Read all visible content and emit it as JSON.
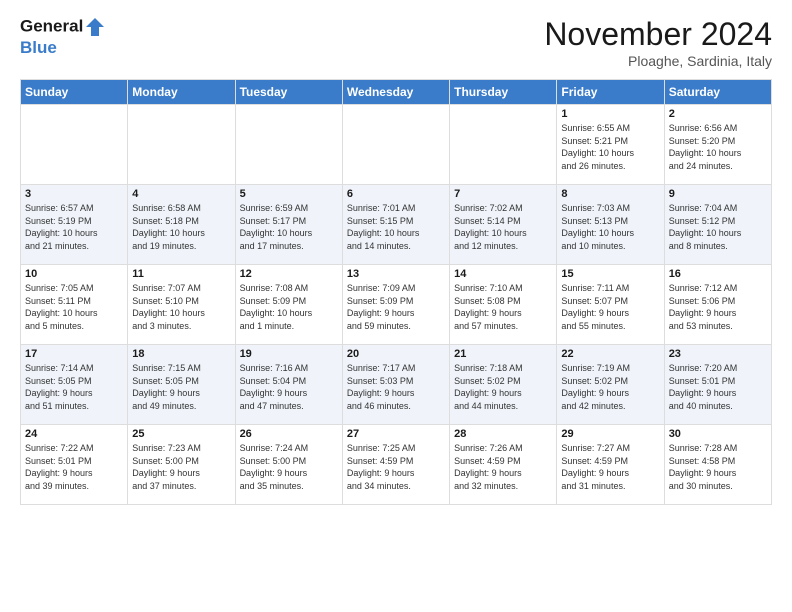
{
  "header": {
    "logo_line1": "General",
    "logo_line2": "Blue",
    "month_title": "November 2024",
    "location": "Ploaghe, Sardinia, Italy"
  },
  "days_of_week": [
    "Sunday",
    "Monday",
    "Tuesday",
    "Wednesday",
    "Thursday",
    "Friday",
    "Saturday"
  ],
  "weeks": [
    [
      {
        "day": "",
        "info": ""
      },
      {
        "day": "",
        "info": ""
      },
      {
        "day": "",
        "info": ""
      },
      {
        "day": "",
        "info": ""
      },
      {
        "day": "",
        "info": ""
      },
      {
        "day": "1",
        "info": "Sunrise: 6:55 AM\nSunset: 5:21 PM\nDaylight: 10 hours\nand 26 minutes."
      },
      {
        "day": "2",
        "info": "Sunrise: 6:56 AM\nSunset: 5:20 PM\nDaylight: 10 hours\nand 24 minutes."
      }
    ],
    [
      {
        "day": "3",
        "info": "Sunrise: 6:57 AM\nSunset: 5:19 PM\nDaylight: 10 hours\nand 21 minutes."
      },
      {
        "day": "4",
        "info": "Sunrise: 6:58 AM\nSunset: 5:18 PM\nDaylight: 10 hours\nand 19 minutes."
      },
      {
        "day": "5",
        "info": "Sunrise: 6:59 AM\nSunset: 5:17 PM\nDaylight: 10 hours\nand 17 minutes."
      },
      {
        "day": "6",
        "info": "Sunrise: 7:01 AM\nSunset: 5:15 PM\nDaylight: 10 hours\nand 14 minutes."
      },
      {
        "day": "7",
        "info": "Sunrise: 7:02 AM\nSunset: 5:14 PM\nDaylight: 10 hours\nand 12 minutes."
      },
      {
        "day": "8",
        "info": "Sunrise: 7:03 AM\nSunset: 5:13 PM\nDaylight: 10 hours\nand 10 minutes."
      },
      {
        "day": "9",
        "info": "Sunrise: 7:04 AM\nSunset: 5:12 PM\nDaylight: 10 hours\nand 8 minutes."
      }
    ],
    [
      {
        "day": "10",
        "info": "Sunrise: 7:05 AM\nSunset: 5:11 PM\nDaylight: 10 hours\nand 5 minutes."
      },
      {
        "day": "11",
        "info": "Sunrise: 7:07 AM\nSunset: 5:10 PM\nDaylight: 10 hours\nand 3 minutes."
      },
      {
        "day": "12",
        "info": "Sunrise: 7:08 AM\nSunset: 5:09 PM\nDaylight: 10 hours\nand 1 minute."
      },
      {
        "day": "13",
        "info": "Sunrise: 7:09 AM\nSunset: 5:09 PM\nDaylight: 9 hours\nand 59 minutes."
      },
      {
        "day": "14",
        "info": "Sunrise: 7:10 AM\nSunset: 5:08 PM\nDaylight: 9 hours\nand 57 minutes."
      },
      {
        "day": "15",
        "info": "Sunrise: 7:11 AM\nSunset: 5:07 PM\nDaylight: 9 hours\nand 55 minutes."
      },
      {
        "day": "16",
        "info": "Sunrise: 7:12 AM\nSunset: 5:06 PM\nDaylight: 9 hours\nand 53 minutes."
      }
    ],
    [
      {
        "day": "17",
        "info": "Sunrise: 7:14 AM\nSunset: 5:05 PM\nDaylight: 9 hours\nand 51 minutes."
      },
      {
        "day": "18",
        "info": "Sunrise: 7:15 AM\nSunset: 5:05 PM\nDaylight: 9 hours\nand 49 minutes."
      },
      {
        "day": "19",
        "info": "Sunrise: 7:16 AM\nSunset: 5:04 PM\nDaylight: 9 hours\nand 47 minutes."
      },
      {
        "day": "20",
        "info": "Sunrise: 7:17 AM\nSunset: 5:03 PM\nDaylight: 9 hours\nand 46 minutes."
      },
      {
        "day": "21",
        "info": "Sunrise: 7:18 AM\nSunset: 5:02 PM\nDaylight: 9 hours\nand 44 minutes."
      },
      {
        "day": "22",
        "info": "Sunrise: 7:19 AM\nSunset: 5:02 PM\nDaylight: 9 hours\nand 42 minutes."
      },
      {
        "day": "23",
        "info": "Sunrise: 7:20 AM\nSunset: 5:01 PM\nDaylight: 9 hours\nand 40 minutes."
      }
    ],
    [
      {
        "day": "24",
        "info": "Sunrise: 7:22 AM\nSunset: 5:01 PM\nDaylight: 9 hours\nand 39 minutes."
      },
      {
        "day": "25",
        "info": "Sunrise: 7:23 AM\nSunset: 5:00 PM\nDaylight: 9 hours\nand 37 minutes."
      },
      {
        "day": "26",
        "info": "Sunrise: 7:24 AM\nSunset: 5:00 PM\nDaylight: 9 hours\nand 35 minutes."
      },
      {
        "day": "27",
        "info": "Sunrise: 7:25 AM\nSunset: 4:59 PM\nDaylight: 9 hours\nand 34 minutes."
      },
      {
        "day": "28",
        "info": "Sunrise: 7:26 AM\nSunset: 4:59 PM\nDaylight: 9 hours\nand 32 minutes."
      },
      {
        "day": "29",
        "info": "Sunrise: 7:27 AM\nSunset: 4:59 PM\nDaylight: 9 hours\nand 31 minutes."
      },
      {
        "day": "30",
        "info": "Sunrise: 7:28 AM\nSunset: 4:58 PM\nDaylight: 9 hours\nand 30 minutes."
      }
    ]
  ]
}
